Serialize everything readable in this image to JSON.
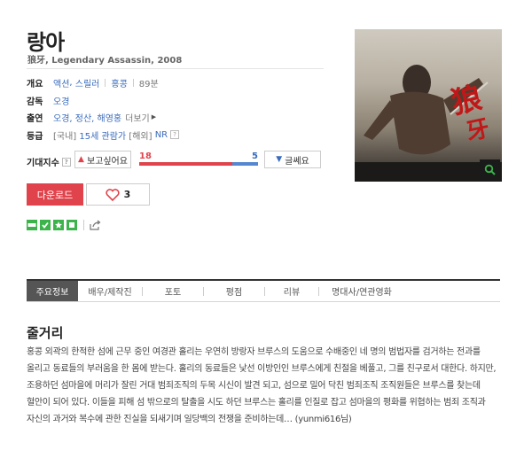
{
  "movie": {
    "title": "랑아",
    "subtitle": "狼牙, Legendary Assassin, 2008"
  },
  "info": {
    "overview_label": "개요",
    "genres": [
      "액션",
      "스릴러"
    ],
    "country": "홍콩",
    "runtime": "89분",
    "director_label": "감독",
    "director": "오경",
    "cast_label": "출연",
    "cast": "오경, 정산, 해영홍",
    "more": "더보기",
    "rating_label": "등급",
    "domestic_tag": "[국내]",
    "domestic_rating": "15세 관람가",
    "overseas_tag": "[해외]",
    "overseas_rating": "NR"
  },
  "expectation": {
    "label": "기대지수",
    "want_label": "보고싶어요",
    "meh_label": "글쎄요",
    "want_count": "18",
    "meh_count": "5",
    "want_ratio": 0.78
  },
  "actions": {
    "download_label": "다운로드",
    "like_count": "3"
  },
  "badges": [
    "DVD",
    "check",
    "star",
    "square"
  ],
  "tabs": [
    "주요정보",
    "배우/제작진",
    "포토",
    "평점",
    "리뷰",
    "명대사/연관영화"
  ],
  "synopsis": {
    "title": "줄거리",
    "text": "홍콩 외곽의 한적한 섬에 근무 중인 여경관 홀리는 우연히 방랑자 브루스의 도움으로 수배중인 네 명의 범법자를 검거하는 전과를 올리고 동료들의 부러움을 한 몸에 받는다. 홀리의 동료들은 낯선 이방인인 브루스에게 친절을 베풀고, 그를 친구로서 대한다. 하지만, 조용하던 섬마을에 머리가 잘린 거대 범죄조직의 두목 시신이 발견 되고, 섬으로 밀어 닥친 범죄조직 조직원들은 브루스를 찾는데 혈안이 되어 있다. 이들을 피해 섬 밖으로의 탈출을 시도 하던 브루스는 홀리를 인질로 잡고 섬마을의 평화를 위협하는 범죄 조직과 자신의 과거와 복수에 관한 진실을 되새기며 일당백의 전쟁을 준비하는데… (yunmi616님)"
  },
  "colors": {
    "accent_red": "#e0434b",
    "link_blue": "#3a6cbd",
    "badge_green": "#3cb44b"
  }
}
